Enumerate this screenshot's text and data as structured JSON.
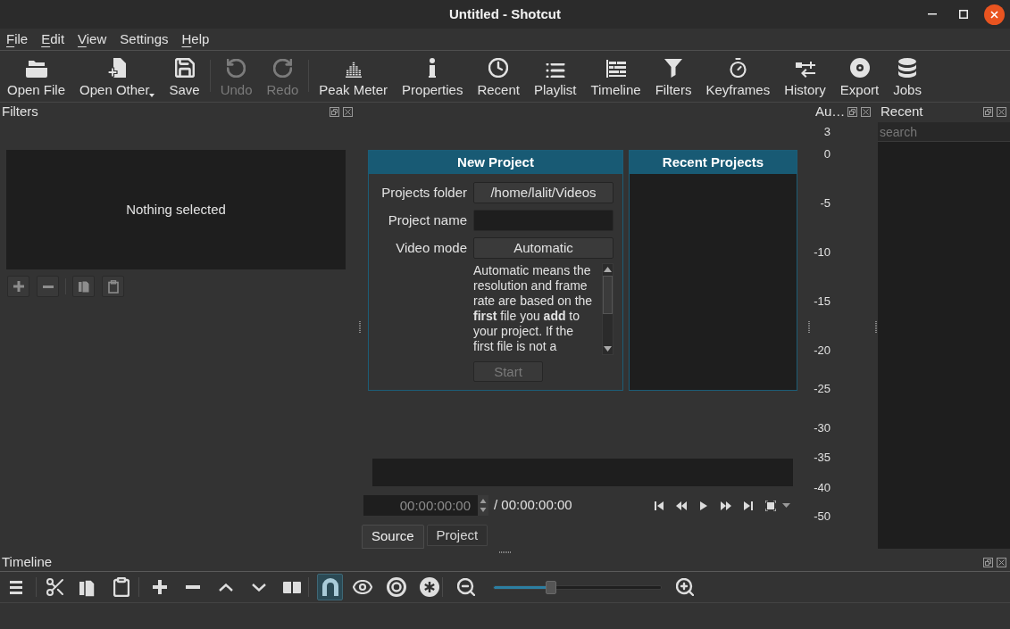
{
  "window": {
    "title": "Untitled - Shotcut"
  },
  "menu_bar": [
    {
      "label": "File",
      "mnemonic": true
    },
    {
      "label": "Edit",
      "mnemonic": true
    },
    {
      "label": "View",
      "mnemonic": true
    },
    {
      "label": "Settings",
      "mnemonic": false
    },
    {
      "label": "Help",
      "mnemonic": true
    }
  ],
  "toolbar": {
    "groups": [
      [
        {
          "label": "Open File",
          "disabled": false,
          "dropdown": false
        },
        {
          "label": "Open Other",
          "disabled": false,
          "dropdown": true
        },
        {
          "label": "Save",
          "disabled": false,
          "dropdown": false
        }
      ],
      [
        {
          "label": "Undo",
          "disabled": true,
          "dropdown": false
        },
        {
          "label": "Redo",
          "disabled": true,
          "dropdown": false
        }
      ],
      [
        {
          "label": "Peak Meter",
          "disabled": false,
          "dropdown": false
        },
        {
          "label": "Properties",
          "disabled": false,
          "dropdown": false
        },
        {
          "label": "Recent",
          "disabled": false,
          "dropdown": false
        },
        {
          "label": "Playlist",
          "disabled": false,
          "dropdown": false
        },
        {
          "label": "Timeline",
          "disabled": false,
          "dropdown": false
        },
        {
          "label": "Filters",
          "disabled": false,
          "dropdown": false
        },
        {
          "label": "Keyframes",
          "disabled": false,
          "dropdown": false
        },
        {
          "label": "History",
          "disabled": false,
          "dropdown": false
        },
        {
          "label": "Export",
          "disabled": false,
          "dropdown": false
        },
        {
          "label": "Jobs",
          "disabled": false,
          "dropdown": false
        }
      ]
    ]
  },
  "filters_dock": {
    "title": "Filters",
    "message": "Nothing selected"
  },
  "new_project": {
    "title": "New Project",
    "fields": [
      {
        "kind": "button",
        "label": "Projects folder",
        "value": "/home/lalit/Videos"
      },
      {
        "kind": "input",
        "label": "Project name"
      },
      {
        "kind": "button",
        "label": "Video mode",
        "value": "Automatic"
      }
    ],
    "description_lines": [
      "Automatic means the",
      "resolution and frame",
      "rate are based on the",
      "**first** file you **add** to",
      "your project. If the",
      "first file is not a"
    ],
    "start_button": {
      "label": "Start",
      "disabled": true
    }
  },
  "recent_projects": {
    "title": "Recent Projects"
  },
  "player": {
    "position": "00:00:00:00",
    "duration": "/ 00:00:00:00",
    "tabs": [
      {
        "label": "Source",
        "selected": true
      },
      {
        "label": "Project",
        "selected": false
      }
    ]
  },
  "audio_meter_dock": {
    "title": "Au…",
    "scale": [
      "3",
      "0",
      "-5",
      "-10",
      "-15",
      "-20",
      "-25",
      "-30",
      "-35",
      "-40",
      "-50"
    ]
  },
  "recent_dock": {
    "title": "Recent",
    "search": {
      "placeholder": "search"
    }
  },
  "timeline_dock": {
    "title": "Timeline",
    "snap": {
      "checked": true
    },
    "zoom_slider": {
      "level": 0.34
    }
  }
}
